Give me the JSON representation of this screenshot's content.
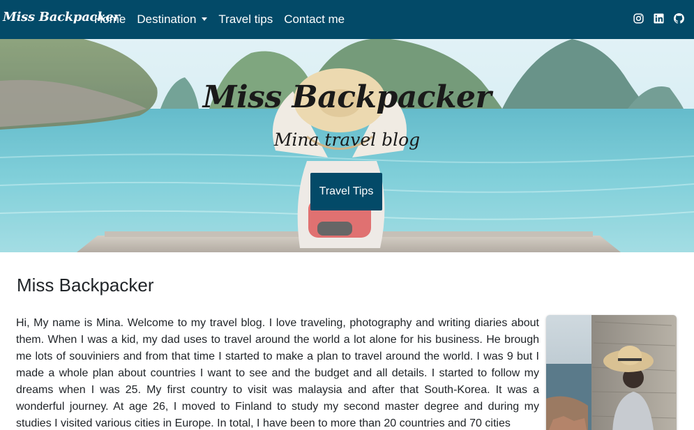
{
  "navbar": {
    "brand": "Miss Backpacker",
    "links": [
      "Home",
      "Destination",
      "Travel tips",
      "Contact me"
    ],
    "social_icons": [
      "instagram-icon",
      "linkedin-icon",
      "github-icon"
    ],
    "background_color": "#034a68"
  },
  "hero": {
    "title": "Miss Backpacker",
    "subtitle": "Mina travel blog",
    "button_label": "Travel Tips"
  },
  "main": {
    "heading": "Miss Backpacker",
    "paragraph": "Hi, My name is Mina. Welcome to my travel blog. I love traveling, photography and writing diaries about them. When I was a kid, my dad uses to travel around the world a lot alone for his business. He brough me lots of souviniers and from that time I started to make a plan to travel around the world. I was 9 but I made a whole plan about countries I want to see and the budget and all details. I started to follow my dreams when I was 25. My first country to visit was malaysia and after that South-Korea. It was a wonderful journey. At age 26, I moved to Finland to study my second master degree and during my studies I visited various cities in Europe. In total, I have been to more than 20 countries and 70 cities"
  }
}
